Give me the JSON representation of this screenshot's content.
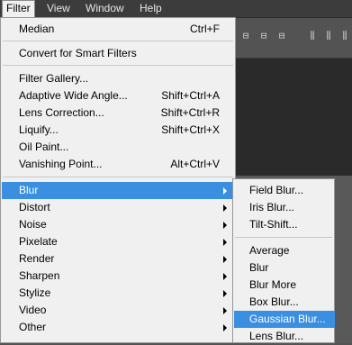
{
  "menubar": {
    "items": [
      "Filter",
      "View",
      "Window",
      "Help"
    ]
  },
  "toolbar": {
    "icons": [
      "align-left-icon",
      "align-center-icon",
      "align-right-icon",
      "distribute-icon",
      "distribute-center-icon",
      "distribute-right-icon"
    ]
  },
  "filter_menu": {
    "items": [
      {
        "label": "Median",
        "shortcut": "Ctrl+F"
      },
      {
        "label": "Convert for Smart Filters",
        "shortcut": ""
      },
      {
        "label": "Filter Gallery...",
        "shortcut": ""
      },
      {
        "label": "Adaptive Wide Angle...",
        "shortcut": "Shift+Ctrl+A"
      },
      {
        "label": "Lens Correction...",
        "shortcut": "Shift+Ctrl+R"
      },
      {
        "label": "Liquify...",
        "shortcut": "Shift+Ctrl+X"
      },
      {
        "label": "Oil Paint...",
        "shortcut": ""
      },
      {
        "label": "Vanishing Point...",
        "shortcut": "Alt+Ctrl+V"
      },
      {
        "label": "Blur",
        "submenu": true,
        "highlighted": true
      },
      {
        "label": "Distort",
        "submenu": true
      },
      {
        "label": "Noise",
        "submenu": true
      },
      {
        "label": "Pixelate",
        "submenu": true
      },
      {
        "label": "Render",
        "submenu": true
      },
      {
        "label": "Sharpen",
        "submenu": true
      },
      {
        "label": "Stylize",
        "submenu": true
      },
      {
        "label": "Video",
        "submenu": true
      },
      {
        "label": "Other",
        "submenu": true
      }
    ]
  },
  "blur_submenu": {
    "items": [
      {
        "label": "Field Blur..."
      },
      {
        "label": "Iris Blur..."
      },
      {
        "label": "Tilt-Shift..."
      },
      {
        "label": "Average"
      },
      {
        "label": "Blur"
      },
      {
        "label": "Blur More"
      },
      {
        "label": "Box Blur..."
      },
      {
        "label": "Gaussian Blur...",
        "highlighted": true
      },
      {
        "label": "Lens Blur..."
      }
    ]
  },
  "colors": {
    "highlight": "#3a8fe0",
    "menu_bg": "#f0f0f0",
    "menubar_bg": "#3c3c3c"
  }
}
